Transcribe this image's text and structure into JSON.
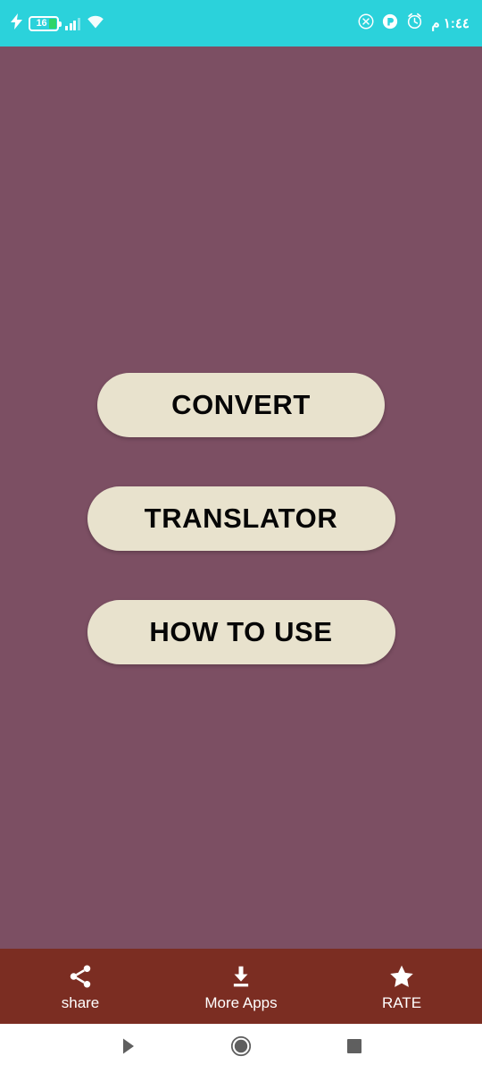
{
  "status_bar": {
    "background_color": "#2bd2db",
    "charging_icon": "lightning-bolt-icon",
    "battery_level": "16",
    "signal_icon": "cellular-signal-icon",
    "wifi_icon": "wifi-icon",
    "mute_icon": "silent-mode-icon",
    "dnd_icon": "do-not-disturb-icon",
    "alarm_icon": "alarm-clock-icon",
    "time": "١:٤٤ م"
  },
  "main": {
    "background_color": "#7c4f63",
    "buttons": [
      {
        "label": "CONVERT",
        "name": "convert-button"
      },
      {
        "label": "TRANSLATOR",
        "name": "translator-button"
      },
      {
        "label": "HOW TO USE",
        "name": "how-to-use-button"
      }
    ],
    "button_color": "#e8e2cd",
    "button_text_color": "#060606"
  },
  "bottom_bar": {
    "background_color": "#7b2d22",
    "items": [
      {
        "label": "share",
        "icon": "share-icon"
      },
      {
        "label": "More Apps",
        "icon": "download-icon"
      },
      {
        "label": "RATE",
        "icon": "star-icon"
      }
    ]
  },
  "nav_bar": {
    "background_color": "#ffffff",
    "back_icon": "back-triangle-icon",
    "home_icon": "home-circle-icon",
    "recents_icon": "recents-square-icon"
  }
}
